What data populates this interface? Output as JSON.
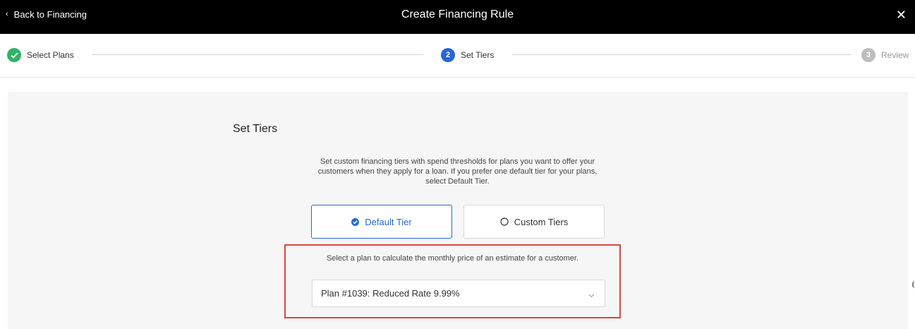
{
  "header": {
    "back_label": "Back to Financing",
    "title": "Create Financing Rule",
    "close_symbol": "✕"
  },
  "stepper": {
    "steps": [
      {
        "label": "Select Plans",
        "status": "complete",
        "marker": ""
      },
      {
        "label": "Set Tiers",
        "status": "active",
        "marker": "2"
      },
      {
        "label": "Review",
        "status": "pending",
        "marker": "3"
      }
    ]
  },
  "main": {
    "section_title": "Set Tiers",
    "description": "Set custom financing tiers with spend thresholds for plans you want to offer your customers when they apply for a loan. If you prefer one default tier for your plans, select Default Tier.",
    "tiers": {
      "default_label": "Default Tier",
      "custom_label": "Custom Tiers",
      "selected": "Default Tier"
    },
    "plan_hint": "Select a plan to calculate the monthly price of an estimate for a customer.",
    "plan_select_value": "Plan #1039: Reduced Rate 9.99%"
  },
  "colors": {
    "accent": "#2767d6",
    "complete": "#2fb36a",
    "highlight_border": "#d9463e"
  }
}
